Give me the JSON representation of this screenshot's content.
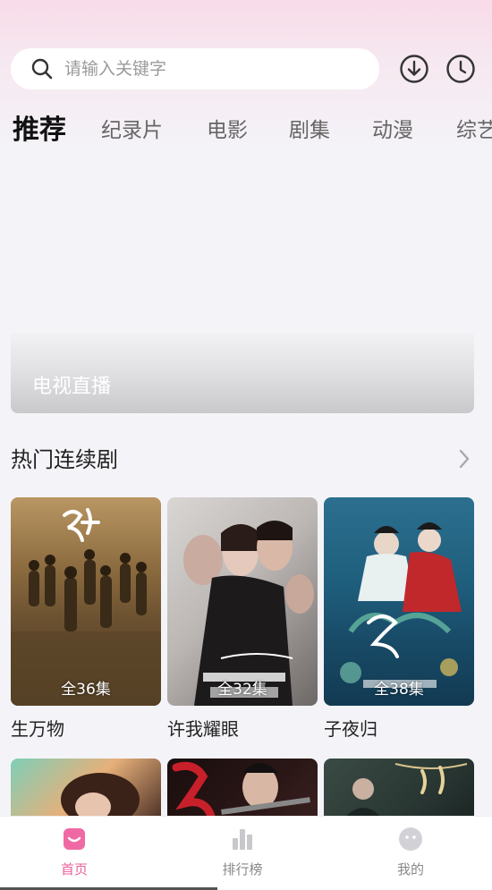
{
  "search": {
    "placeholder": "请输入关键字"
  },
  "header_icons": [
    "download-icon",
    "history-icon"
  ],
  "tabs": [
    {
      "label": "推荐",
      "active": true
    },
    {
      "label": "纪录片"
    },
    {
      "label": "电影"
    },
    {
      "label": "剧集"
    },
    {
      "label": "动漫"
    },
    {
      "label": "综艺"
    }
  ],
  "banner": {
    "label": "电视直播"
  },
  "section": {
    "title": "热门连续剧"
  },
  "shows": [
    {
      "title": "生万物",
      "episodes": "全36集"
    },
    {
      "title": "许我耀眼",
      "episodes": "全32集"
    },
    {
      "title": "子夜归",
      "episodes": "全38集"
    }
  ],
  "nav": [
    {
      "label": "首页",
      "active": true
    },
    {
      "label": "排行榜"
    },
    {
      "label": "我的"
    }
  ],
  "colors": {
    "accent": "#e8609a",
    "header_pink": "#f8dbe8"
  }
}
